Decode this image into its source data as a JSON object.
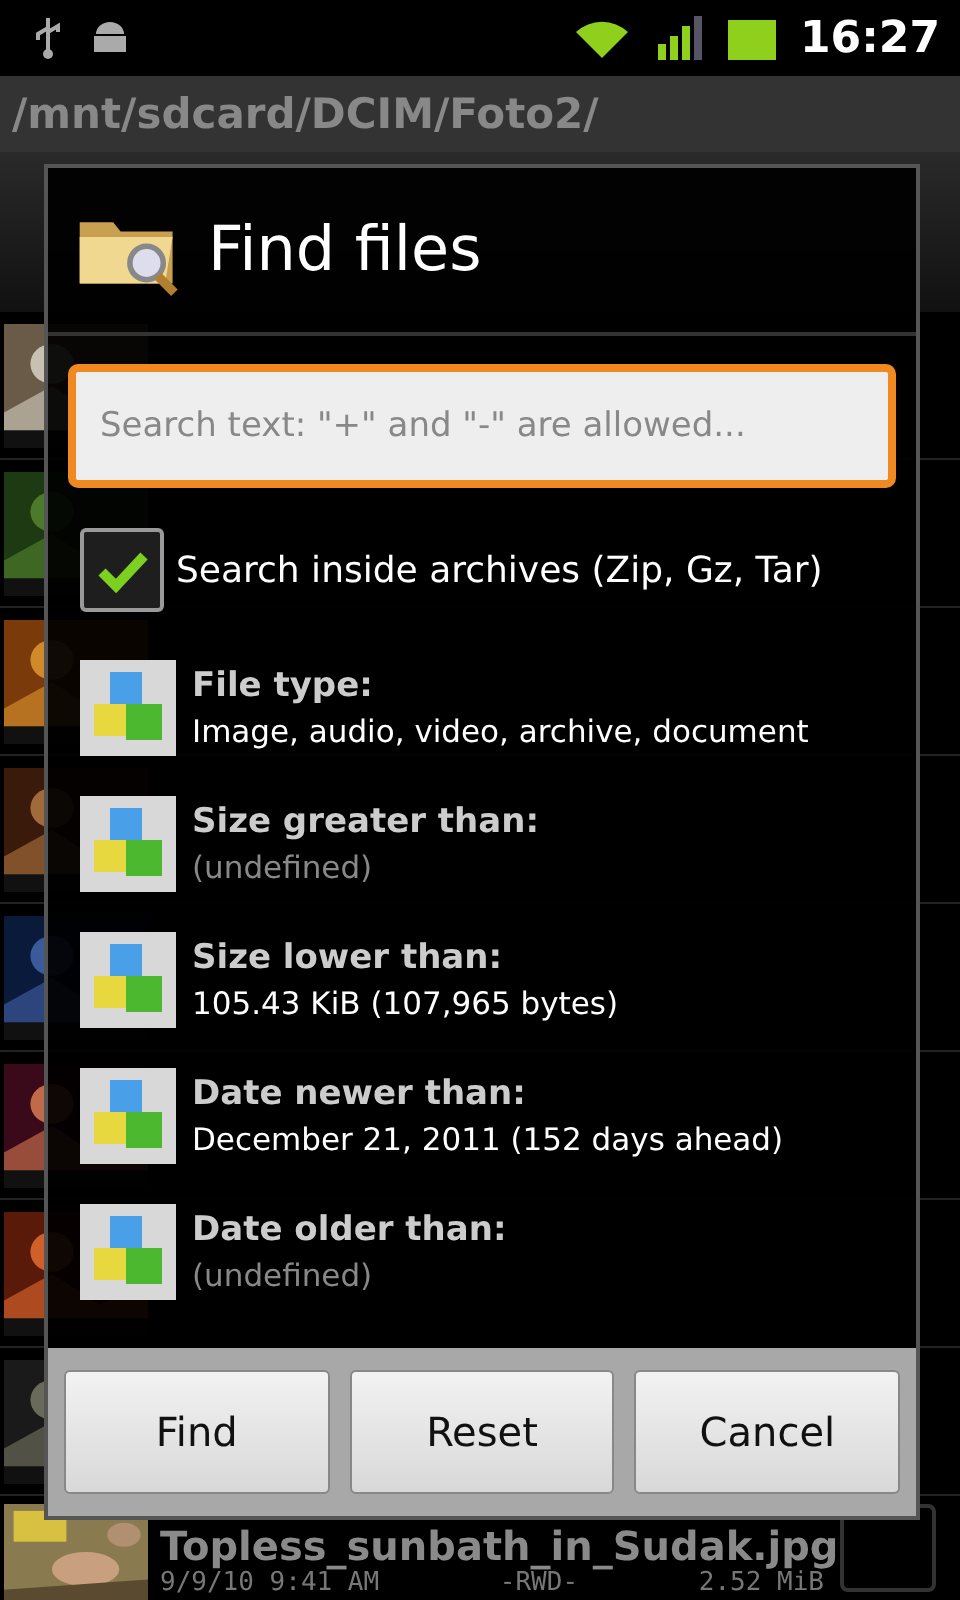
{
  "status_bar": {
    "time": "16:27"
  },
  "path_bar": {
    "path": "/mnt/sdcard/DCIM/Foto2/"
  },
  "file_list": {
    "visible_row": {
      "name": "Topless_sunbath_in_Sudak.jpg",
      "date": "9/9/10 9:41 AM",
      "attributes": "-RWD-",
      "size": "2.52 MiB",
      "checked": false
    }
  },
  "dialog": {
    "title": "Find files",
    "search": {
      "placeholder": "Search text: \"+\" and \"-\" are allowed..."
    },
    "archives": {
      "label": "Search inside archives (Zip, Gz, Tar)",
      "checked": true
    },
    "filters": [
      {
        "title": "File type:",
        "value": "Image, audio, video, archive, document",
        "defined": true
      },
      {
        "title": "Size greater than:",
        "value": "(undefined)",
        "defined": false
      },
      {
        "title": "Size lower than:",
        "value": "105.43 KiB (107,965 bytes)",
        "defined": true
      },
      {
        "title": "Date newer than:",
        "value": "December 21, 2011 (152 days ahead)",
        "defined": true
      },
      {
        "title": "Date older than:",
        "value": "(undefined)",
        "defined": false
      }
    ],
    "buttons": [
      "Find",
      "Reset",
      "Cancel"
    ]
  }
}
